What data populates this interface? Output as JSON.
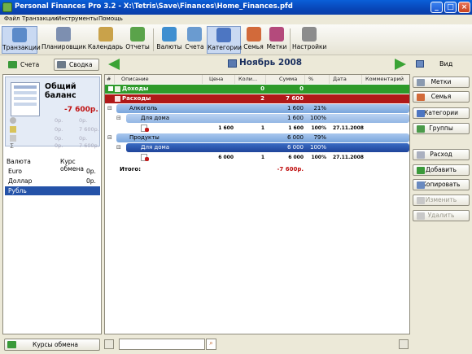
{
  "window": {
    "title": "Personal Finances Pro 3.2 - X:\\Tetris\\Save\\Finances\\Home_Finances.pfd"
  },
  "menu": [
    "Файл",
    "Транзакции",
    "Инструменты",
    "Помощь"
  ],
  "toolbar": [
    {
      "label": "Транзакции",
      "icon": "transactions-icon",
      "color": "#5b8ac9"
    },
    {
      "label": "Планировщик",
      "icon": "scheduler-icon",
      "color": "#7d8fb0"
    },
    {
      "label": "Календарь",
      "icon": "calendar-icon",
      "color": "#c9a24a"
    },
    {
      "label": "Отчеты",
      "icon": "reports-icon",
      "color": "#5aa34a"
    },
    {
      "label": "Валюты",
      "icon": "currencies-icon",
      "color": "#3f8fd0"
    },
    {
      "label": "Счета",
      "icon": "accounts-icon",
      "color": "#6a9bd0"
    },
    {
      "label": "Категории",
      "icon": "categories-icon",
      "color": "#4d76c2"
    },
    {
      "label": "Семья",
      "icon": "family-icon",
      "color": "#d26a3a"
    },
    {
      "label": "Метки",
      "icon": "tags-icon",
      "color": "#b44a7c"
    },
    {
      "label": "Настройки",
      "icon": "settings-icon",
      "color": "#8c8c8c"
    }
  ],
  "nav": {
    "accounts_btn": "Счета",
    "summary_btn": "Сводка",
    "period": "Ноябрь 2008",
    "view_btn": "Вид"
  },
  "balance": {
    "title": "Общий баланс",
    "amount": "-7 600р.",
    "rows": [
      "0р.",
      "7 600р.",
      "0р.",
      "7 600р."
    ]
  },
  "currencies": {
    "col1": "Валюта",
    "col2": "Курс обмена",
    "items": [
      {
        "name": "Euro",
        "rate": "0р."
      },
      {
        "name": "Доллар",
        "rate": "0р."
      },
      {
        "name": "Рубль",
        "rate": ""
      }
    ],
    "button": "Курсы обмена"
  },
  "grid": {
    "headers": [
      "#",
      "Описание",
      "Цена",
      "Коли...",
      "Сумма",
      "%",
      "Дата",
      "Комментарий"
    ],
    "rows": [
      {
        "kind": "income",
        "desc": "Доходы",
        "qty": "0",
        "sum": "0",
        "pct": "",
        "price": "",
        "date": ""
      },
      {
        "kind": "expense",
        "desc": "Расходы",
        "qty": "2",
        "sum": "7 600",
        "pct": "",
        "price": "",
        "date": ""
      },
      {
        "kind": "cat",
        "desc": "Алкоголь",
        "qty": "",
        "sum": "1 600",
        "pct": "21%",
        "price": "",
        "date": ""
      },
      {
        "kind": "sub",
        "desc": "Для дома",
        "qty": "",
        "sum": "1 600",
        "pct": "100%",
        "price": "",
        "date": ""
      },
      {
        "kind": "item",
        "desc": "",
        "price": "1 600",
        "qty": "1",
        "sum": "1 600",
        "pct": "100%",
        "date": "27.11.2008"
      },
      {
        "kind": "cat",
        "desc": "Продукты",
        "qty": "",
        "sum": "6 000",
        "pct": "79%",
        "price": "",
        "date": ""
      },
      {
        "kind": "subsel",
        "desc": "Для дома",
        "qty": "",
        "sum": "6 000",
        "pct": "100%",
        "price": "",
        "date": ""
      },
      {
        "kind": "item",
        "desc": "",
        "price": "6 000",
        "qty": "1",
        "sum": "6 000",
        "pct": "100%",
        "date": "27.11.2008"
      }
    ],
    "total_label": "Итого:",
    "total_value": "-7 600р."
  },
  "right": {
    "tags": "Метки",
    "family": "Семья",
    "categories": "Категории",
    "groups": "Группы",
    "expense": "Расход",
    "add": "Добавить",
    "copy": "Копировать",
    "edit": "Изменить",
    "delete": "Удалить"
  },
  "search": {
    "placeholder": ""
  },
  "colors": {
    "income": "#2e9a2a",
    "expense": "#b01818",
    "category": "#7aa5dc",
    "selected": "#2452a8"
  }
}
